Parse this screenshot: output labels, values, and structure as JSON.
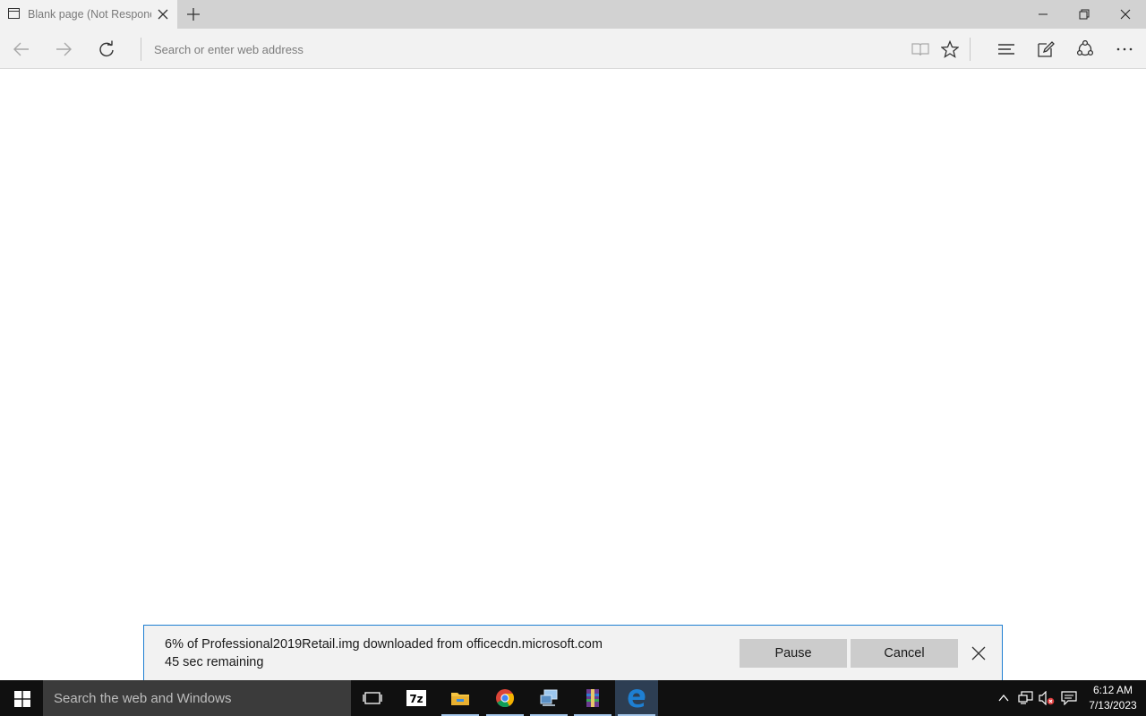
{
  "browser": {
    "tab_title": "Blank page (Not Responding)",
    "address_placeholder": "Search or enter web address"
  },
  "download": {
    "status_text": "6% of Professional2019Retail.img downloaded from officecdn.microsoft.com",
    "time_remaining": "45 sec remaining",
    "progress_percent": 6,
    "pause_label": "Pause",
    "cancel_label": "Cancel"
  },
  "taskbar": {
    "search_placeholder": "Search the web and Windows",
    "apps": [
      "task-view",
      "7-zip",
      "file-explorer",
      "chrome",
      "network-tool",
      "winrar",
      "edge"
    ],
    "clock_time": "6:12 AM",
    "clock_date": "7/13/2023"
  },
  "colors": {
    "accent": "#1e7fd2",
    "taskbar": "#101010",
    "toolbar": "#f2f2f2"
  }
}
